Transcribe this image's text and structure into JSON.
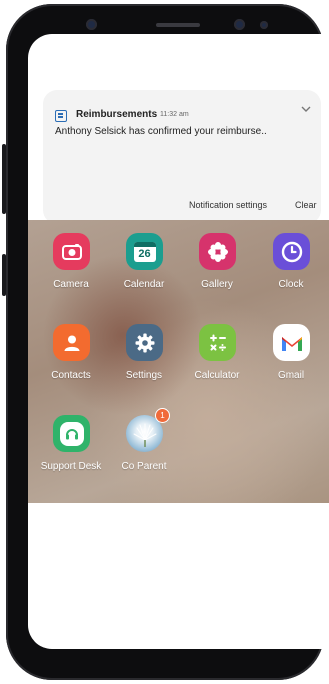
{
  "notification": {
    "app_name": "Reimbursements",
    "time": "11:32 am",
    "message": "Anthony Selsick has confirmed your reimburse..",
    "settings_label": "Notification settings",
    "clear_label": "Clear",
    "expand_icon": "chevron-down-icon"
  },
  "apps": [
    {
      "label": "Camera",
      "icon": "camera-icon",
      "color": "#e53b5e"
    },
    {
      "label": "Calendar",
      "icon": "calendar-icon",
      "color": "#1b9e8f",
      "date": "26"
    },
    {
      "label": "Gallery",
      "icon": "flower-icon",
      "color": "#d6336c"
    },
    {
      "label": "Clock",
      "icon": "clock-icon",
      "color": "#6a4fd8"
    },
    {
      "label": "Contacts",
      "icon": "person-icon",
      "color": "#f36b2f"
    },
    {
      "label": "Settings",
      "icon": "gear-icon",
      "color": "#4b6a86"
    },
    {
      "label": "Calculator",
      "icon": "calculator-icon",
      "color": "#7cc242"
    },
    {
      "label": "Gmail",
      "icon": "gmail-icon",
      "color": "#ffffff"
    },
    {
      "label": "Support Desk",
      "icon": "headset-icon",
      "color": "#2fb36a"
    },
    {
      "label": "Co Parent",
      "icon": "dandelion-icon",
      "color": "#8fb8d6",
      "badge": "1"
    }
  ]
}
